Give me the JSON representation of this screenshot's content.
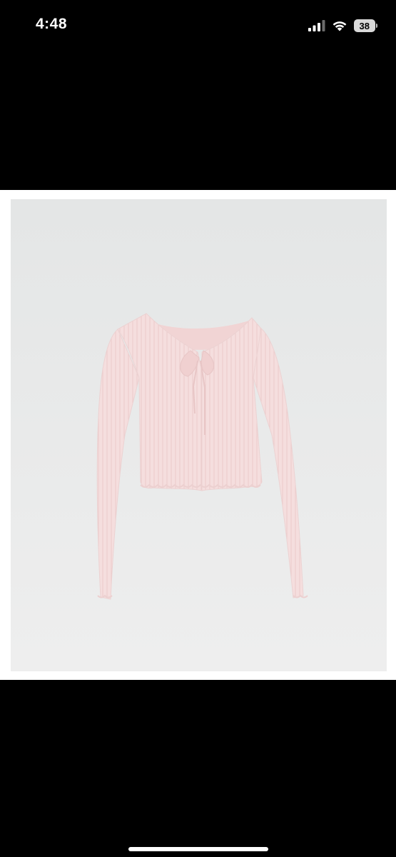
{
  "status_bar": {
    "time": "4:48",
    "battery_level": "38",
    "signal_icon": "cellular-signal-icon",
    "wifi_icon": "wifi-icon",
    "battery_icon": "battery-icon"
  },
  "image_viewer": {
    "content": "product-photo",
    "subject_icon": "cardigan-icon"
  },
  "colors": {
    "background": "#000000",
    "photo_background": "#e9eaea",
    "garment": "#f4dcdc"
  }
}
